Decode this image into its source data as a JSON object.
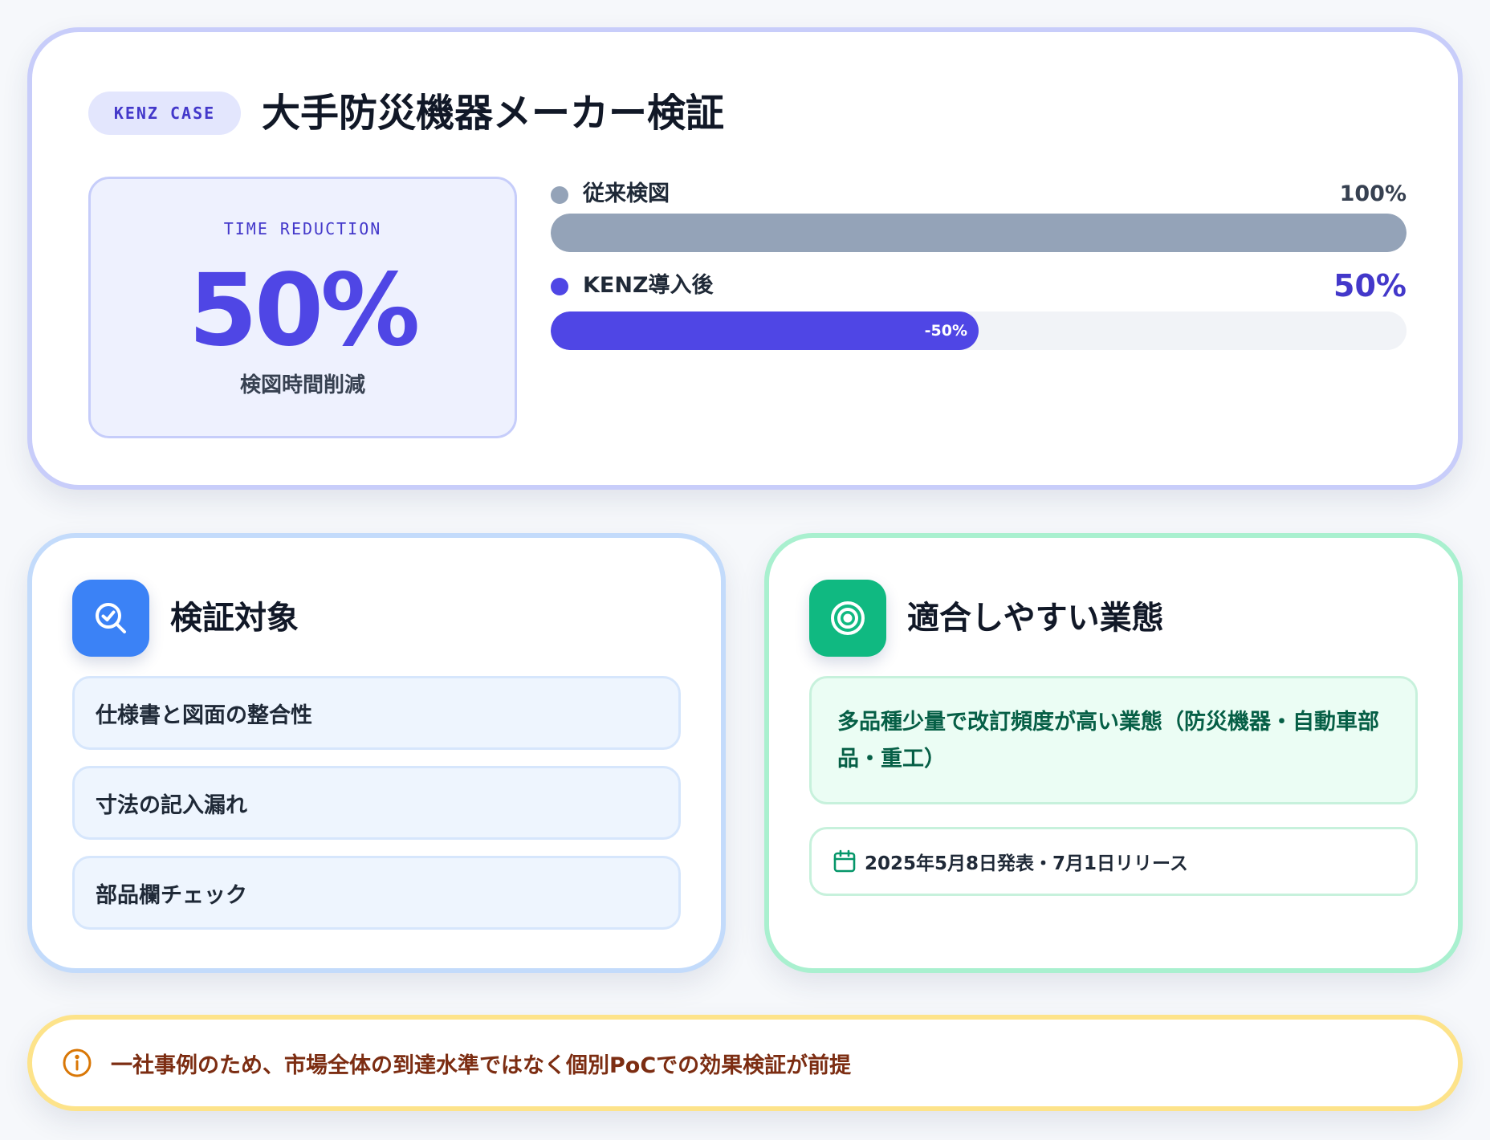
{
  "header": {
    "badge": "KENZ CASE",
    "title": "大手防災機器メーカー検証"
  },
  "stat": {
    "label": "TIME REDUCTION",
    "value": "50%",
    "description": "検図時間削減"
  },
  "comparison": [
    {
      "name": "従来検図",
      "percent_label": "100%",
      "fraction": 1.0,
      "fill_label": "",
      "color": "#94a3b8",
      "pct_color": "#374151"
    },
    {
      "name": "KENZ導入後",
      "percent_label": "50%",
      "fraction": 0.5,
      "fill_label": "-50%",
      "color": "#4f46e5",
      "pct_color": "#4338ca"
    }
  ],
  "verification": {
    "title": "検証対象",
    "icon": "search-check-icon",
    "items": [
      "仕様書と図面の整合性",
      "寸法の記入漏れ",
      "部品欄チェック"
    ]
  },
  "fit": {
    "title": "適合しやすい業態",
    "icon": "target-icon",
    "description": "多品種少量で改訂頻度が高い業態（防災機器・自動車部品・重工）",
    "date_icon": "calendar-icon",
    "date": "2025年5月8日発表・7月1日リリース"
  },
  "note": {
    "icon": "info-icon",
    "text": "一社事例のため、市場全体の到達水準ではなく個別PoCでの効果検証が前提"
  },
  "colors": {
    "accent": "#4f46e5",
    "blue_tile": "#3b82f6",
    "green_tile": "#10b981",
    "note_icon": "#d97706"
  }
}
